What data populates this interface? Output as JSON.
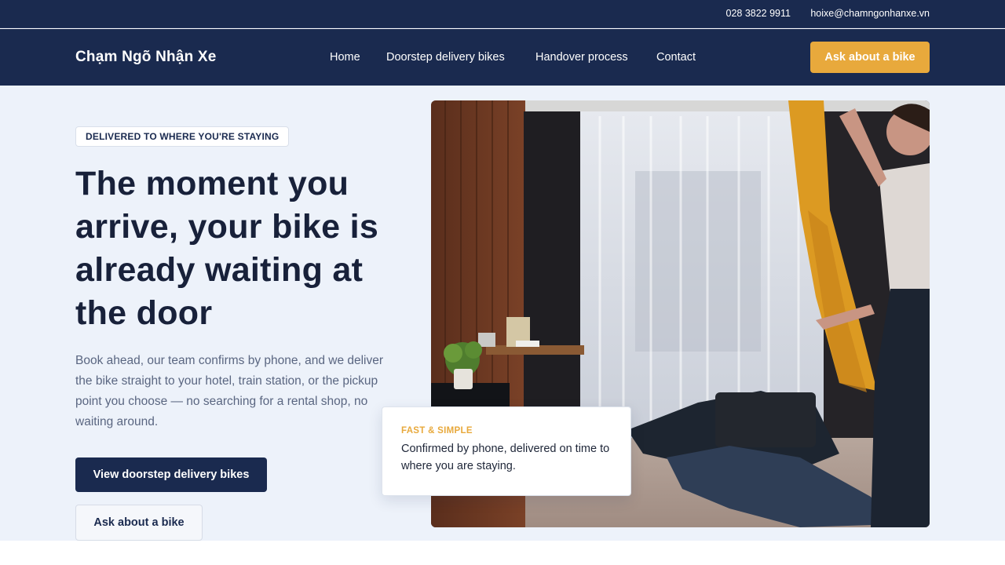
{
  "topbar": {
    "phone": "028 3822 9911",
    "email": "hoixe@chamngonhanxe.vn"
  },
  "nav": {
    "brand": "Chạm Ngõ Nhận Xe",
    "items": [
      {
        "label": "Home"
      },
      {
        "label": "Doorstep delivery bikes"
      },
      {
        "label": "Handover process"
      },
      {
        "label": "Contact"
      }
    ],
    "cta": "Ask about a bike"
  },
  "hero": {
    "badge": "DELIVERED TO WHERE YOU'RE STAYING",
    "headline": "The moment you arrive, your bike is already waiting at the door",
    "lead": "Book ahead, our team confirms by phone, and we deliver the bike straight to your hotel, train station, or the pickup point you choose — no searching for a rental shop, no waiting around.",
    "primary_button": "View doorstep delivery bikes",
    "secondary_button": "Ask about a bike",
    "image_icon": "hotel-room-photo"
  },
  "card": {
    "kicker": "FAST & SIMPLE",
    "text": "Confirmed by phone, delivered on time to where you are staying."
  },
  "colors": {
    "navy": "#1a2a4f",
    "accent": "#e8a93c",
    "hero_bg": "#edf2fa"
  }
}
